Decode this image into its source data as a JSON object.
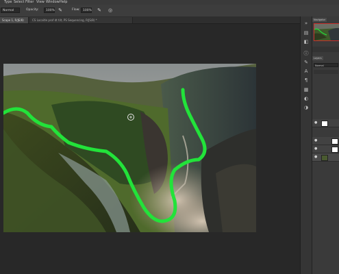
{
  "menu": {
    "items": [
      "Type",
      "Select",
      "Filter",
      "View",
      "Window",
      "Help"
    ]
  },
  "options": {
    "mode": "Normal",
    "opacity_label": "Opacity:",
    "opacity_value": "100%",
    "flow_label": "Flow:",
    "flow_value": "100%"
  },
  "tabs": [
    {
      "label": "Scape 1, R/JE/8) *",
      "active": true
    },
    {
      "label": "CS Locaitle prof dt tilt, PS Sequencing, R/JS/8) *",
      "active": false
    }
  ],
  "panels": {
    "navigator_label": "Navigator",
    "blend_label": "Normal",
    "layers_label": "Layers"
  },
  "stroke_color": "#22e33a"
}
